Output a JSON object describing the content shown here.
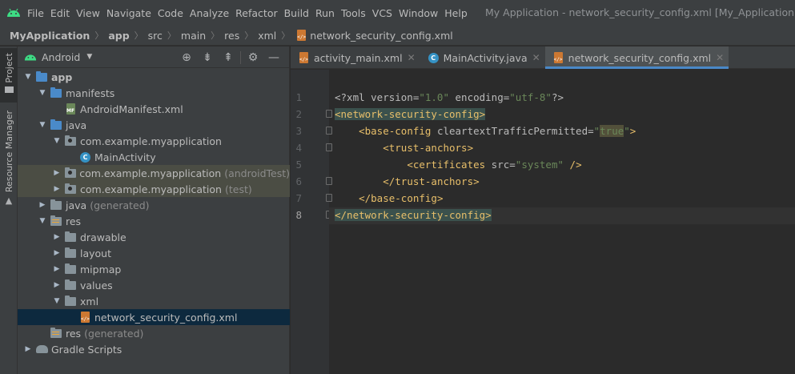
{
  "menu": {
    "items": [
      "File",
      "Edit",
      "View",
      "Navigate",
      "Code",
      "Analyze",
      "Refactor",
      "Build",
      "Run",
      "Tools",
      "VCS",
      "Window",
      "Help"
    ],
    "window_title": "My Application - network_security_config.xml [My_Application.app]"
  },
  "breadcrumb": [
    "MyApplication",
    "app",
    "src",
    "main",
    "res",
    "xml",
    "network_security_config.xml"
  ],
  "toolstripe": {
    "project_label": "Project",
    "resource_manager_label": "Resource Manager"
  },
  "project_panel": {
    "view_mode": "Android"
  },
  "tree": {
    "app": "app",
    "manifests": "manifests",
    "android_manifest": "AndroidManifest.xml",
    "java": "java",
    "pkg_main": "com.example.myapplication",
    "main_activity": "MainActivity",
    "pkg_android_test": "com.example.myapplication",
    "pkg_android_test_suffix": "(androidTest)",
    "pkg_test": "com.example.myapplication",
    "pkg_test_suffix": "(test)",
    "java_generated": "java",
    "java_generated_suffix": "(generated)",
    "res": "res",
    "drawable": "drawable",
    "layout": "layout",
    "mipmap": "mipmap",
    "values": "values",
    "xml": "xml",
    "nsc_file": "network_security_config.xml",
    "res_generated": "res",
    "res_generated_suffix": "(generated)",
    "gradle_scripts": "Gradle Scripts"
  },
  "tabs": [
    {
      "label": "activity_main.xml",
      "icon": "xml-file-icon"
    },
    {
      "label": "MainActivity.java",
      "icon": "class-icon"
    },
    {
      "label": "network_security_config.xml",
      "icon": "xml-file-icon",
      "active": true
    }
  ],
  "editor": {
    "line_numbers": [
      "1",
      "2",
      "3",
      "4",
      "5",
      "6",
      "7",
      "8"
    ],
    "current_line": "8",
    "code": {
      "l1_a": "<?xml version=",
      "l1_b": "\"1.0\"",
      "l1_c": " encoding=",
      "l1_d": "\"utf-8\"",
      "l1_e": "?>",
      "l2": "<network-security-config>",
      "l3_indent": "    ",
      "l3_tag": "<base-config",
      "l3_attr": " cleartextTrafficPermitted=",
      "l3_q1": "\"",
      "l3_val": "true",
      "l3_q2": "\"",
      "l3_end": ">",
      "l4_indent": "        ",
      "l4_tag": "<trust-anchors>",
      "l5_indent": "            ",
      "l5_tag": "<certificates",
      "l5_attr": " src=",
      "l5_val": "\"system\"",
      "l5_end": " />",
      "l6_indent": "        ",
      "l6_tag": "</trust-anchors>",
      "l7_indent": "    ",
      "l7_tag": "</base-config>",
      "l8": "</network-security-config>"
    }
  },
  "colors": {
    "menubar_bg": "#3c3f41",
    "editor_bg": "#2b2b2b",
    "xml_tag": "#e8bf6a",
    "xml_value": "#6a8759",
    "active_tab_underline": "#4a88c7",
    "selection_bg": "#0d293e"
  }
}
